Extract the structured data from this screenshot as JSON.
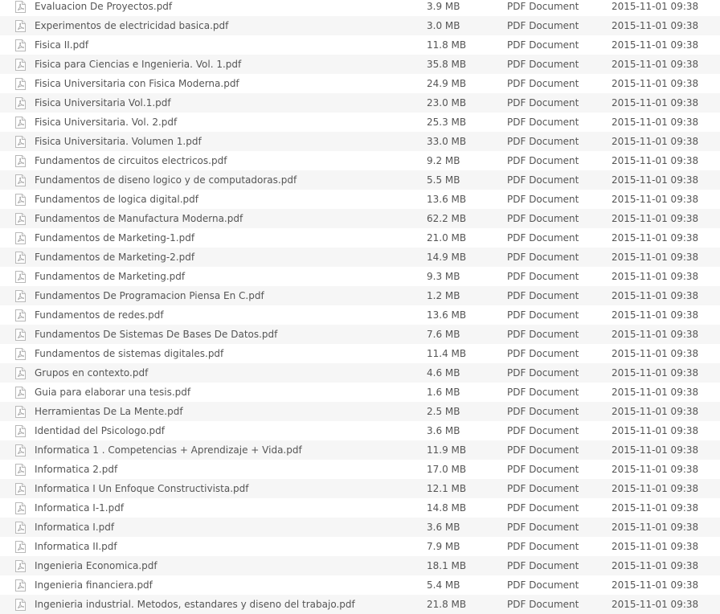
{
  "file_list": {
    "icon": "pdf-file-icon",
    "rows": [
      {
        "name": "Evaluacion De Proyectos.pdf",
        "size": "3.9 MB",
        "type": "PDF Document",
        "modified": "2015-11-01 09:38"
      },
      {
        "name": "Experimentos de electricidad basica.pdf",
        "size": "3.0 MB",
        "type": "PDF Document",
        "modified": "2015-11-01 09:38"
      },
      {
        "name": "Fisica II.pdf",
        "size": "11.8 MB",
        "type": "PDF Document",
        "modified": "2015-11-01 09:38"
      },
      {
        "name": "Fisica para Ciencias e Ingenieria. Vol. 1.pdf",
        "size": "35.8 MB",
        "type": "PDF Document",
        "modified": "2015-11-01 09:38"
      },
      {
        "name": "Fisica Universitaria con Fisica Moderna.pdf",
        "size": "24.9 MB",
        "type": "PDF Document",
        "modified": "2015-11-01 09:38"
      },
      {
        "name": "Fisica Universitaria Vol.1.pdf",
        "size": "23.0 MB",
        "type": "PDF Document",
        "modified": "2015-11-01 09:38"
      },
      {
        "name": "Fisica Universitaria. Vol. 2.pdf",
        "size": "25.3 MB",
        "type": "PDF Document",
        "modified": "2015-11-01 09:38"
      },
      {
        "name": "Fisica Universitaria. Volumen 1.pdf",
        "size": "33.0 MB",
        "type": "PDF Document",
        "modified": "2015-11-01 09:38"
      },
      {
        "name": "Fundamentos de circuitos electricos.pdf",
        "size": "9.2 MB",
        "type": "PDF Document",
        "modified": "2015-11-01 09:38"
      },
      {
        "name": "Fundamentos de diseno logico y de computadoras.pdf",
        "size": "5.5 MB",
        "type": "PDF Document",
        "modified": "2015-11-01 09:38"
      },
      {
        "name": "Fundamentos de logica digital.pdf",
        "size": "13.6 MB",
        "type": "PDF Document",
        "modified": "2015-11-01 09:38"
      },
      {
        "name": "Fundamentos de Manufactura Moderna.pdf",
        "size": "62.2 MB",
        "type": "PDF Document",
        "modified": "2015-11-01 09:38"
      },
      {
        "name": "Fundamentos de Marketing-1.pdf",
        "size": "21.0 MB",
        "type": "PDF Document",
        "modified": "2015-11-01 09:38"
      },
      {
        "name": "Fundamentos de Marketing-2.pdf",
        "size": "14.9 MB",
        "type": "PDF Document",
        "modified": "2015-11-01 09:38"
      },
      {
        "name": "Fundamentos de Marketing.pdf",
        "size": "9.3 MB",
        "type": "PDF Document",
        "modified": "2015-11-01 09:38"
      },
      {
        "name": "Fundamentos De Programacion Piensa En C.pdf",
        "size": "1.2 MB",
        "type": "PDF Document",
        "modified": "2015-11-01 09:38"
      },
      {
        "name": "Fundamentos de redes.pdf",
        "size": "13.6 MB",
        "type": "PDF Document",
        "modified": "2015-11-01 09:38"
      },
      {
        "name": "Fundamentos De Sistemas De Bases De Datos.pdf",
        "size": "7.6 MB",
        "type": "PDF Document",
        "modified": "2015-11-01 09:38"
      },
      {
        "name": "Fundamentos de sistemas digitales.pdf",
        "size": "11.4 MB",
        "type": "PDF Document",
        "modified": "2015-11-01 09:38"
      },
      {
        "name": "Grupos en contexto.pdf",
        "size": "4.6 MB",
        "type": "PDF Document",
        "modified": "2015-11-01 09:38"
      },
      {
        "name": "Guia para elaborar una tesis.pdf",
        "size": "1.6 MB",
        "type": "PDF Document",
        "modified": "2015-11-01 09:38"
      },
      {
        "name": "Herramientas De La Mente.pdf",
        "size": "2.5 MB",
        "type": "PDF Document",
        "modified": "2015-11-01 09:38"
      },
      {
        "name": "Identidad del Psicologo.pdf",
        "size": "3.6 MB",
        "type": "PDF Document",
        "modified": "2015-11-01 09:38"
      },
      {
        "name": "Informatica 1 . Competencias + Aprendizaje + Vida.pdf",
        "size": "11.9 MB",
        "type": "PDF Document",
        "modified": "2015-11-01 09:38"
      },
      {
        "name": "Informatica 2.pdf",
        "size": "17.0 MB",
        "type": "PDF Document",
        "modified": "2015-11-01 09:38"
      },
      {
        "name": "Informatica I Un Enfoque Constructivista.pdf",
        "size": "12.1 MB",
        "type": "PDF Document",
        "modified": "2015-11-01 09:38"
      },
      {
        "name": "Informatica I-1.pdf",
        "size": "14.8 MB",
        "type": "PDF Document",
        "modified": "2015-11-01 09:38"
      },
      {
        "name": "Informatica I.pdf",
        "size": "3.6 MB",
        "type": "PDF Document",
        "modified": "2015-11-01 09:38"
      },
      {
        "name": "Informatica II.pdf",
        "size": "7.9 MB",
        "type": "PDF Document",
        "modified": "2015-11-01 09:38"
      },
      {
        "name": "Ingenieria Economica.pdf",
        "size": "18.1 MB",
        "type": "PDF Document",
        "modified": "2015-11-01 09:38"
      },
      {
        "name": "Ingenieria financiera.pdf",
        "size": "5.4 MB",
        "type": "PDF Document",
        "modified": "2015-11-01 09:38"
      },
      {
        "name": "Ingenieria industrial. Metodos, estandares y diseno del trabajo.pdf",
        "size": "21.8 MB",
        "type": "PDF Document",
        "modified": "2015-11-01 09:38"
      }
    ]
  }
}
